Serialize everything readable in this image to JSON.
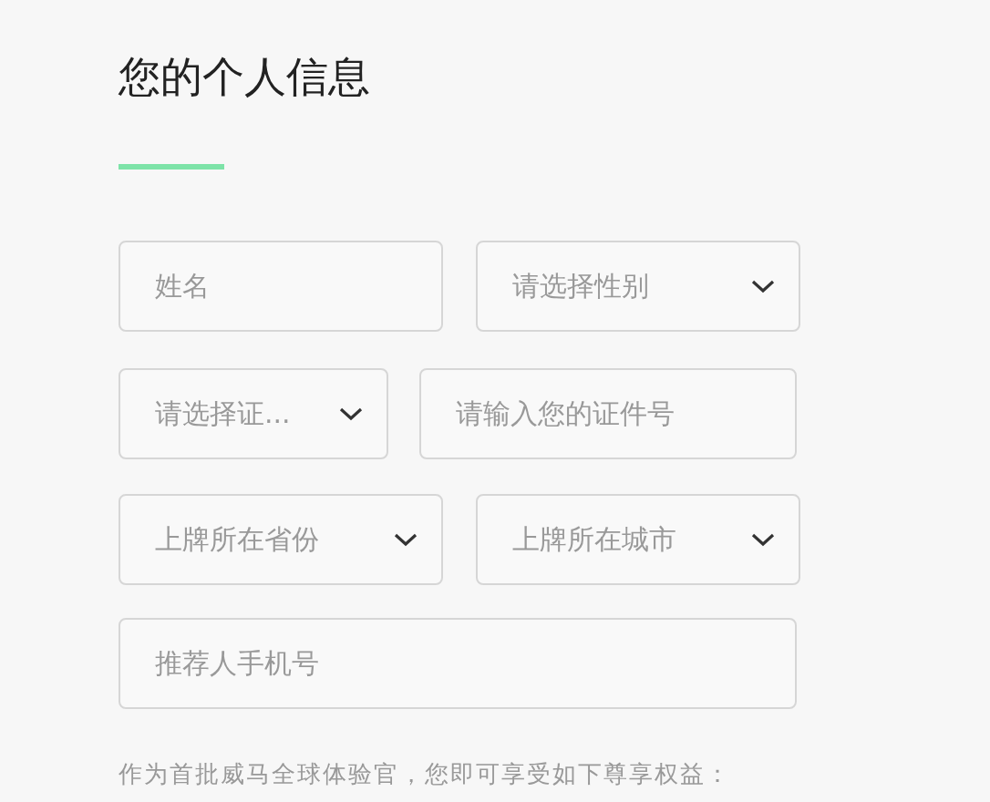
{
  "title": "您的个人信息",
  "form_rows": [
    [
      {
        "kind": "input",
        "placeholder": "姓名"
      },
      {
        "kind": "select",
        "placeholder": "请选择性别"
      }
    ],
    [
      {
        "kind": "select",
        "placeholder": "请选择证..."
      },
      {
        "kind": "input",
        "placeholder": "请输入您的证件号"
      }
    ],
    [
      {
        "kind": "select",
        "placeholder": "上牌所在省份"
      },
      {
        "kind": "select",
        "placeholder": "上牌所在城市"
      }
    ],
    [
      {
        "kind": "input",
        "placeholder": "推荐人手机号"
      }
    ]
  ],
  "note": "作为首批威马全球体验官，您即可享受如下尊享权益："
}
